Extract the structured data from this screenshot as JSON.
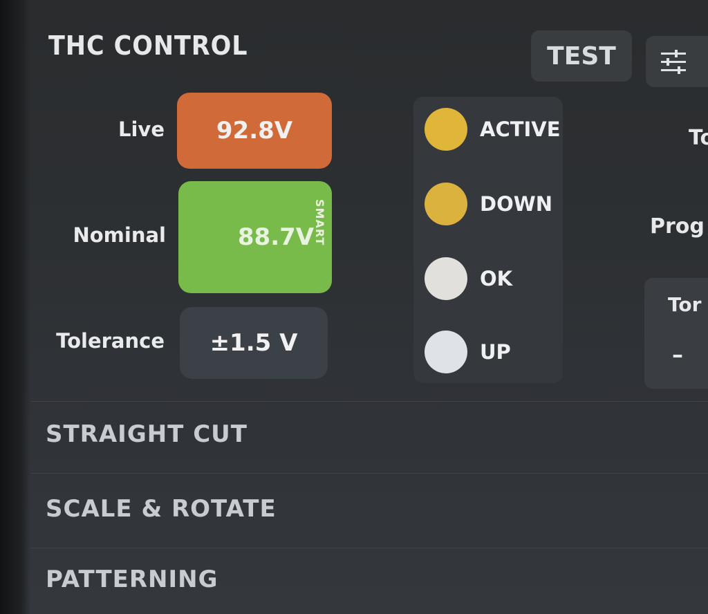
{
  "header": {
    "title": "THC CONTROL",
    "test_label": "TEST"
  },
  "readings": {
    "live_label": "Live",
    "live_value": "92.8V",
    "nominal_label": "Nominal",
    "nominal_value": "88.7V",
    "nominal_tag": "SMART",
    "tolerance_label": "Tolerance",
    "tolerance_value": "±1.5 V"
  },
  "indicators": [
    {
      "label": "ACTIVE",
      "color": "#e0b63a"
    },
    {
      "label": "DOWN",
      "color": "#dcb23e"
    },
    {
      "label": "OK",
      "color": "#e2e0dc"
    },
    {
      "label": "UP",
      "color": "#dfe3e8"
    }
  ],
  "right_panel": {
    "label_1": "To",
    "label_2": "Prog",
    "torch_label": "Tor",
    "minus_label": "–"
  },
  "sections": [
    {
      "label": "STRAIGHT CUT"
    },
    {
      "label": "SCALE & ROTATE"
    },
    {
      "label": "PATTERNING"
    }
  ],
  "colors": {
    "live": "#d06a38",
    "nominal": "#78bb4a",
    "panel": "#35393d"
  }
}
